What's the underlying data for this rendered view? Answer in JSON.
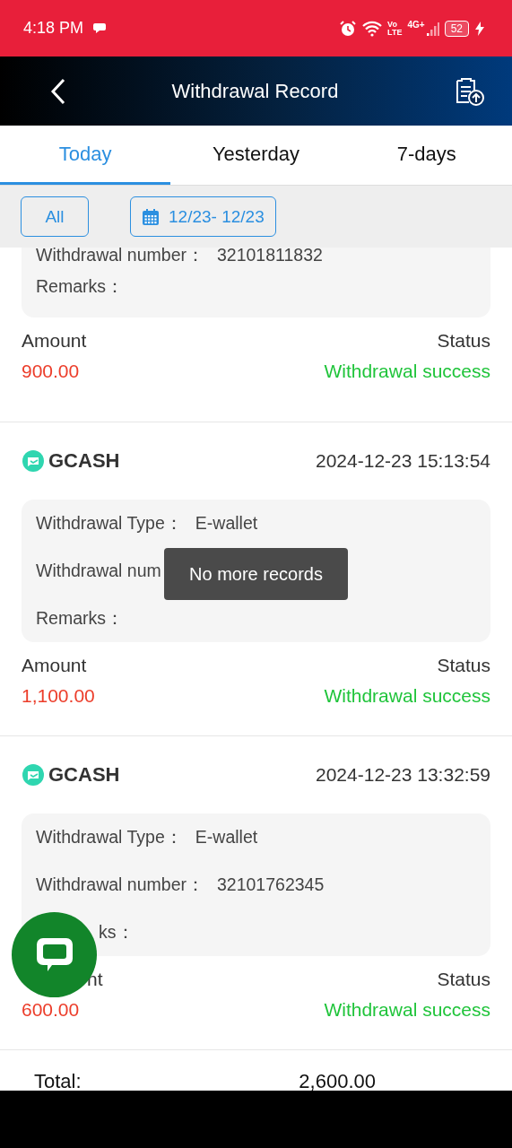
{
  "status_bar": {
    "time": "4:18 PM",
    "network_top": "Vo",
    "network_bottom": "LTE",
    "mobile": "4G+",
    "battery": "52"
  },
  "header": {
    "title": "Withdrawal Record"
  },
  "tabs": [
    {
      "label": "Today",
      "selected": true
    },
    {
      "label": "Yesterday",
      "selected": false
    },
    {
      "label": "7-days",
      "selected": false
    }
  ],
  "filters": {
    "type_button": "All",
    "date_range": "12/23- 12/23"
  },
  "records": [
    {
      "partial": true,
      "under_chat_button": false,
      "fields": [
        {
          "label": "Withdrawal number：",
          "value": "32101811832"
        },
        {
          "label": "Remarks："
        }
      ],
      "amount_label": "Amount",
      "amount": "900.00",
      "status_label": "Status",
      "status": "Withdrawal success"
    },
    {
      "partial": false,
      "under_chat_button": false,
      "method": "GCASH",
      "time": "2024-12-23 15:13:54",
      "fields": [
        {
          "label": "Withdrawal Type：",
          "value": "E-wallet"
        },
        {
          "label": "Withdrawal num"
        },
        {
          "label": "Remarks："
        }
      ],
      "amount_label": "Amount",
      "amount": "1,100.00",
      "status_label": "Status",
      "status": "Withdrawal success"
    },
    {
      "partial": false,
      "under_chat_button": true,
      "method": "GCASH",
      "time": "2024-12-23 13:32:59",
      "fields": [
        {
          "label": "Withdrawal Type：",
          "value": "E-wallet"
        },
        {
          "label": "Withdrawal number：",
          "value": "32101762345"
        },
        {
          "label": "ks："
        }
      ],
      "amount_label": "nt",
      "amount": "600.00",
      "status_label": "Status",
      "status": "Withdrawal success"
    }
  ],
  "total": {
    "label": "Total:",
    "value": "2,600.00"
  },
  "toast": "No more records"
}
